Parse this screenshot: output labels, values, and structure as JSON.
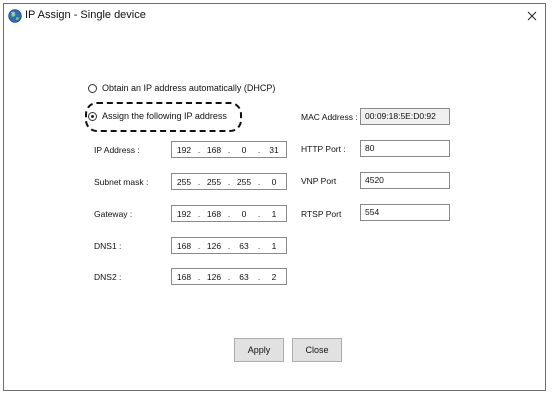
{
  "window": {
    "title": "IP Assign - Single device"
  },
  "mode": {
    "dhcp_label": "Obtain an IP address automatically (DHCP)",
    "static_label": "Assign the following IP address",
    "selected": "static"
  },
  "network": {
    "ip_address": {
      "label": "IP Address :",
      "octets": [
        "192",
        "168",
        "0",
        "31"
      ]
    },
    "subnet_mask": {
      "label": "Subnet mask :",
      "octets": [
        "255",
        "255",
        "255",
        "0"
      ]
    },
    "gateway": {
      "label": "Gateway :",
      "octets": [
        "192",
        "168",
        "0",
        "1"
      ]
    },
    "dns1": {
      "label": "DNS1 :",
      "octets": [
        "168",
        "126",
        "63",
        "1"
      ]
    },
    "dns2": {
      "label": "DNS2 :",
      "octets": [
        "168",
        "126",
        "63",
        "2"
      ]
    }
  },
  "ports": {
    "mac": {
      "label": "MAC Address :",
      "value": "00:09:18:5E:D0:92"
    },
    "http": {
      "label": "HTTP Port :",
      "value": "80"
    },
    "vnp": {
      "label": "VNP Port",
      "value": "4520"
    },
    "rtsp": {
      "label": "RTSP Port",
      "value": "554"
    }
  },
  "buttons": {
    "apply": "Apply",
    "close": "Close"
  },
  "icons": {
    "app": "globe-icon",
    "close": "close-icon"
  }
}
